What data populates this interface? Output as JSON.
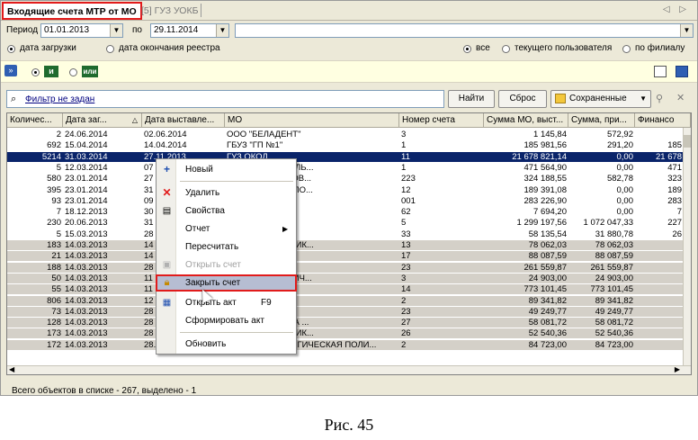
{
  "tabs": {
    "active": "Входящие счета МТР от МО",
    "inactive": "[5] ГУЗ УОКБ",
    "nav": "◁ ▷"
  },
  "period": {
    "from_label": "Период с",
    "from": "01.01.2013",
    "to_label": "по",
    "to": "29.11.2014"
  },
  "date_options": {
    "upload": "дата загрузки",
    "end": "дата окончания реестра"
  },
  "scope_options": {
    "all": "все",
    "current_user": "текущего пользователя",
    "by_branch": "по филиалу"
  },
  "logic": {
    "and": "и",
    "or": "или"
  },
  "filter": {
    "text": "Фильтр не задан",
    "find": "Найти",
    "reset": "Сброс",
    "saved": "Сохраненные"
  },
  "columns": [
    "Количес...",
    "Дата заг...",
    "Дата выставле...",
    "МО",
    "Номер счета",
    "Сумма МО, выст...",
    "Сумма, при...",
    "Финансо"
  ],
  "rows": [
    [
      "2",
      "24.06.2014",
      "02.06.2014",
      "ООО \"БЕЛАДЕНТ\"",
      "3",
      "1 145,84",
      "572,92",
      "5"
    ],
    [
      "692",
      "15.04.2014",
      "14.04.2014",
      "ГБУЗ \"ГП №1\"",
      "1",
      "185 981,56",
      "291,20",
      "185 6"
    ],
    [
      "5214",
      "31.03.2014",
      "27.11.2013",
      "ГУЗ ОКОД",
      "11",
      "21 678 821,14",
      "0,00",
      "21 678 8"
    ],
    [
      "5",
      "12.03.2014",
      "07",
      "ЕКЦИОННАЯ БОЛЬ...",
      "1",
      "471 564,90",
      "0,00",
      "471 5"
    ],
    [
      "580",
      "23.01.2014",
      "27",
      "1 РФ ПО УЛЬЯНОВ...",
      "223",
      "324 188,55",
      "582,78",
      "323 6"
    ],
    [
      "395",
      "23.01.2014",
      "31",
      "ОЛОГИЧЕСКАЯ ПО...",
      "12",
      "189 391,08",
      "0,00",
      "189 3"
    ],
    [
      "93",
      "23.01.2014",
      "09",
      "ЦРБ\"",
      "001",
      "283 226,90",
      "0,00",
      "283 2"
    ],
    [
      "7",
      "18.12.2013",
      "30",
      "ЬЯНОВСКА",
      "62",
      "7 694,20",
      "0,00",
      "7 6"
    ],
    [
      "230",
      "20.06.2013",
      "31",
      "",
      "5",
      "1 299 197,56",
      "1 072 047,33",
      "227 1"
    ],
    [
      "5",
      "15.03.2013",
      "28",
      "",
      "33",
      "58 135,54",
      "31 880,78",
      "26 2"
    ],
    [
      "183",
      "14.03.2013",
      "14",
      "Я ДЕТСКАЯ ПОЛИК...",
      "13",
      "78 062,03",
      "78 062,03",
      ""
    ],
    [
      "21",
      "14.03.2013",
      "14",
      "ЦРБ",
      "17",
      "88 087,59",
      "88 087,59",
      ""
    ],
    [
      "188",
      "14.03.2013",
      "28",
      "КАЯ ЦРБ",
      "23",
      "261 559,87",
      "261 559,87",
      ""
    ],
    [
      "50",
      "14.03.2013",
      "11",
      "Я СТОМАТОЛОГИЧ...",
      "3",
      "24 903,00",
      "24 903,00",
      ""
    ],
    [
      "55",
      "14.03.2013",
      "11",
      "",
      "14",
      "773 101,45",
      "773 101,45",
      ""
    ],
    [
      "806",
      "14.03.2013",
      "12",
      "ГА (И)",
      "2",
      "89 341,82",
      "89 341,82",
      ""
    ],
    [
      "73",
      "14.03.2013",
      "28",
      "КАЯ ЦРБ",
      "23",
      "49 249,77",
      "49 249,77",
      ""
    ],
    [
      "128",
      "14.03.2013",
      "28",
      "Я ПОЛИКЛИНИКА ...",
      "27",
      "58 081,72",
      "58 081,72",
      ""
    ],
    [
      "173",
      "14.03.2013",
      "28",
      "Я ДЕТСКАЯ ПОЛИК...",
      "26",
      "52 540,36",
      "52 540,36",
      ""
    ],
    [
      "172",
      "14.03.2013",
      "28.02.2013",
      "ГУЗ СТОМАТОЛОГИЧЕСКАЯ ПОЛИ...",
      "2",
      "84 723,00",
      "84 723,00",
      ""
    ]
  ],
  "context_menu": {
    "new": "Новый",
    "delete": "Удалить",
    "properties": "Свойства",
    "report": "Отчет",
    "recalculate": "Пересчитать",
    "open_invoice": "Открыть счет",
    "close_invoice": "Закрыть счет",
    "open_act": "Открыть акт",
    "open_act_shortcut": "F9",
    "form_act": "Сформировать акт",
    "refresh": "Обновить"
  },
  "status": "Всего объектов в списке - 267, выделено - 1",
  "caption": "Рис. 45",
  "colors": {
    "highlight_border": "#e11b1b",
    "selection": "#0a246a",
    "gray_row": "#d4d0c8"
  }
}
